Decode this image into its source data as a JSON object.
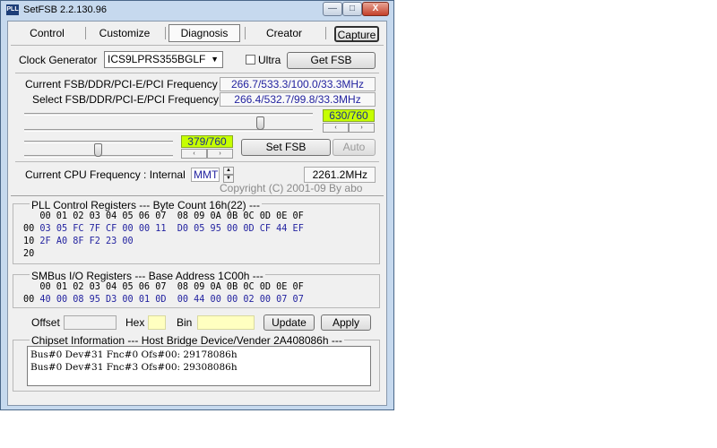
{
  "window": {
    "title": "SetFSB 2.2.130.96",
    "app_icon_text": "PLL"
  },
  "title_buttons": {
    "minimize": "—",
    "maximize": "□",
    "close": "X"
  },
  "tabs": [
    {
      "label": "Control"
    },
    {
      "label": "Customize"
    },
    {
      "label": "Diagnosis",
      "selected": true
    },
    {
      "label": "Creator"
    }
  ],
  "capture_label": "Capture",
  "clock": {
    "label": "Clock Generator",
    "value": "ICS9LPRS355BGLF",
    "ultra_label": "Ultra",
    "ultra_checked": false,
    "get_fsb_label": "Get FSB"
  },
  "freq": {
    "current_label": "Current FSB/DDR/PCI-E/PCI Frequency",
    "current_value": "266.7/533.3/100.0/33.3MHz",
    "select_label": "Select FSB/DDR/PCI-E/PCI Frequency",
    "select_value": "266.4/532.7/99.8/33.3MHz"
  },
  "slider1": {
    "value_text": "630/760",
    "position": 630,
    "max": 760
  },
  "slider2": {
    "value_text": "379/760",
    "position": 379,
    "max": 760
  },
  "spin_glyphs": {
    "left": "‹",
    "right": "›",
    "up": "▲",
    "down": "▼"
  },
  "set_fsb_label": "Set FSB",
  "auto_label": "Auto",
  "cpu": {
    "label": "Current CPU Frequency : Internal",
    "mode": "MMT",
    "value": "2261.2MHz"
  },
  "copyright": "Copyright (C) 2001-09 By abo",
  "pll": {
    "title": "PLL Control Registers  --- Byte Count 16h(22) ---",
    "header": "   00 01 02 03 04 05 06 07  08 09 0A 0B 0C 0D 0E 0F",
    "rows": [
      {
        "addr": "00",
        "values": "03 05 FC 7F CF 00 00 11  D0 05 95 00 0D CF 44 EF"
      },
      {
        "addr": "10",
        "values": "2F A0 8F F2 23 00"
      },
      {
        "addr": "20",
        "values": ""
      }
    ]
  },
  "smbus": {
    "title": "SMBus I/O Registers  --- Base Address 1C00h ---",
    "header": "   00 01 02 03 04 05 06 07  08 09 0A 0B 0C 0D 0E 0F",
    "rows": [
      {
        "addr": "00",
        "values": "40 00 08 95 D3 00 01 0D  00 44 00 00 02 00 07 07"
      }
    ]
  },
  "edit": {
    "offset_label": "Offset",
    "hex_label": "Hex",
    "bin_label": "Bin",
    "update_label": "Update",
    "apply_label": "Apply"
  },
  "chipset": {
    "title": "Chipset Information  --- Host Bridge Device/Vender 2A408086h ---",
    "lines": [
      "Bus#0 Dev#31 Fnc#0 Ofs#00: 29178086h",
      "Bus#0 Dev#31 Fnc#3 Ofs#00: 29308086h"
    ]
  }
}
